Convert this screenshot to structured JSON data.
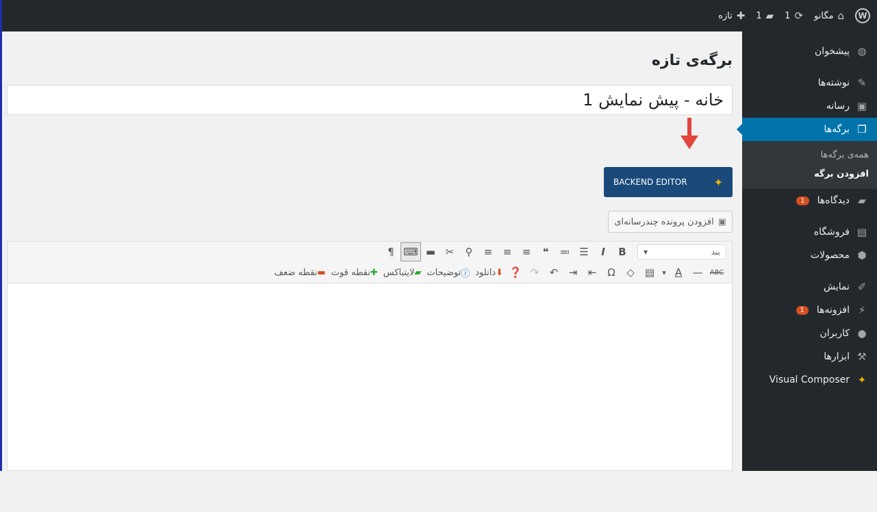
{
  "adminbar": {
    "site_name": "مگانو",
    "updates_count": "1",
    "comments_count": "1",
    "new_label": "تازه"
  },
  "sidebar": {
    "items": [
      {
        "label": "پیشخوان",
        "icon": "dashboard-icon"
      },
      {
        "label": "نوشته‌ها",
        "icon": "pin-icon"
      },
      {
        "label": "رسانه",
        "icon": "media-icon"
      },
      {
        "label": "برگه‌ها",
        "icon": "pages-icon"
      },
      {
        "label": "دیدگاه‌ها",
        "icon": "comment-icon",
        "badge": "1"
      },
      {
        "label": "فروشگاه",
        "icon": "woo-icon"
      },
      {
        "label": "محصولات",
        "icon": "box-icon"
      },
      {
        "label": "نمایش",
        "icon": "brush-icon"
      },
      {
        "label": "افزونه‌ها",
        "icon": "plugin-icon",
        "badge": "1"
      },
      {
        "label": "کاربران",
        "icon": "user-icon"
      },
      {
        "label": "ابزارها",
        "icon": "wrench-icon"
      },
      {
        "label": "Visual Composer",
        "icon": "vc-icon"
      }
    ],
    "submenu": [
      {
        "label": "همه‌ی برگه‌ها"
      },
      {
        "label": "افزودن برگه"
      }
    ]
  },
  "main": {
    "page_title": "برگه‌ی تازه",
    "title_value": "خانه - پیش نمایش 1",
    "backend_editor_label": "BACKEND EDITOR",
    "add_media_label": "افزودن پرونده چندرسانه‌ای"
  },
  "toolbar": {
    "format_value": "بند",
    "download_label": "دانلود",
    "notes_label": "توضیحات",
    "lightbox_label": "لایتباکس",
    "strength_label": "نقطه قوت",
    "weakness_label": "نقطه ضعف"
  },
  "colors": {
    "adminbar": "#23282d",
    "current_menu": "#0073aa",
    "backend_button": "#1a4a7a",
    "arrow": "#e2453c",
    "badge": "#d54e21"
  }
}
